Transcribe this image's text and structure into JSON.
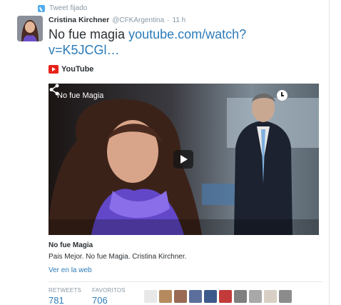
{
  "pinned": {
    "label": "Tweet fijado",
    "icon": "pin-icon"
  },
  "tweet": {
    "author_name": "Cristina Kirchner",
    "author_handle": "@CFKArgentina",
    "separator": "·",
    "time": "11 h",
    "text_prefix": "No fue magia ",
    "link_text": "youtube.com/watch?v=K5JCGl…"
  },
  "card": {
    "source": "YouTube",
    "video_title": "No fue Magia",
    "title": "No fue Magia",
    "description": "Pais Mejor. No fue Magia. Cristina Kirchner.",
    "view_link": "Ver en la web"
  },
  "stats": {
    "retweets_label": "RETWEETS",
    "retweets_value": "781",
    "favorites_label": "FAVORITOS",
    "favorites_value": "706"
  },
  "colors": {
    "link": "#2b7bb9",
    "meta": "#8899a6",
    "youtube_red": "#e62117",
    "pin_blue": "#55acee"
  },
  "favoriters": [
    {
      "color": "#e8e8e8"
    },
    {
      "color": "#b58a5e"
    },
    {
      "color": "#9a6a54"
    },
    {
      "color": "#5c6e9c"
    },
    {
      "color": "#3e5a8a"
    },
    {
      "color": "#c23a3a"
    },
    {
      "color": "#7f7f7f"
    },
    {
      "color": "#a8a8a8"
    },
    {
      "color": "#d8d0c4"
    },
    {
      "color": "#8c8c8c"
    }
  ]
}
